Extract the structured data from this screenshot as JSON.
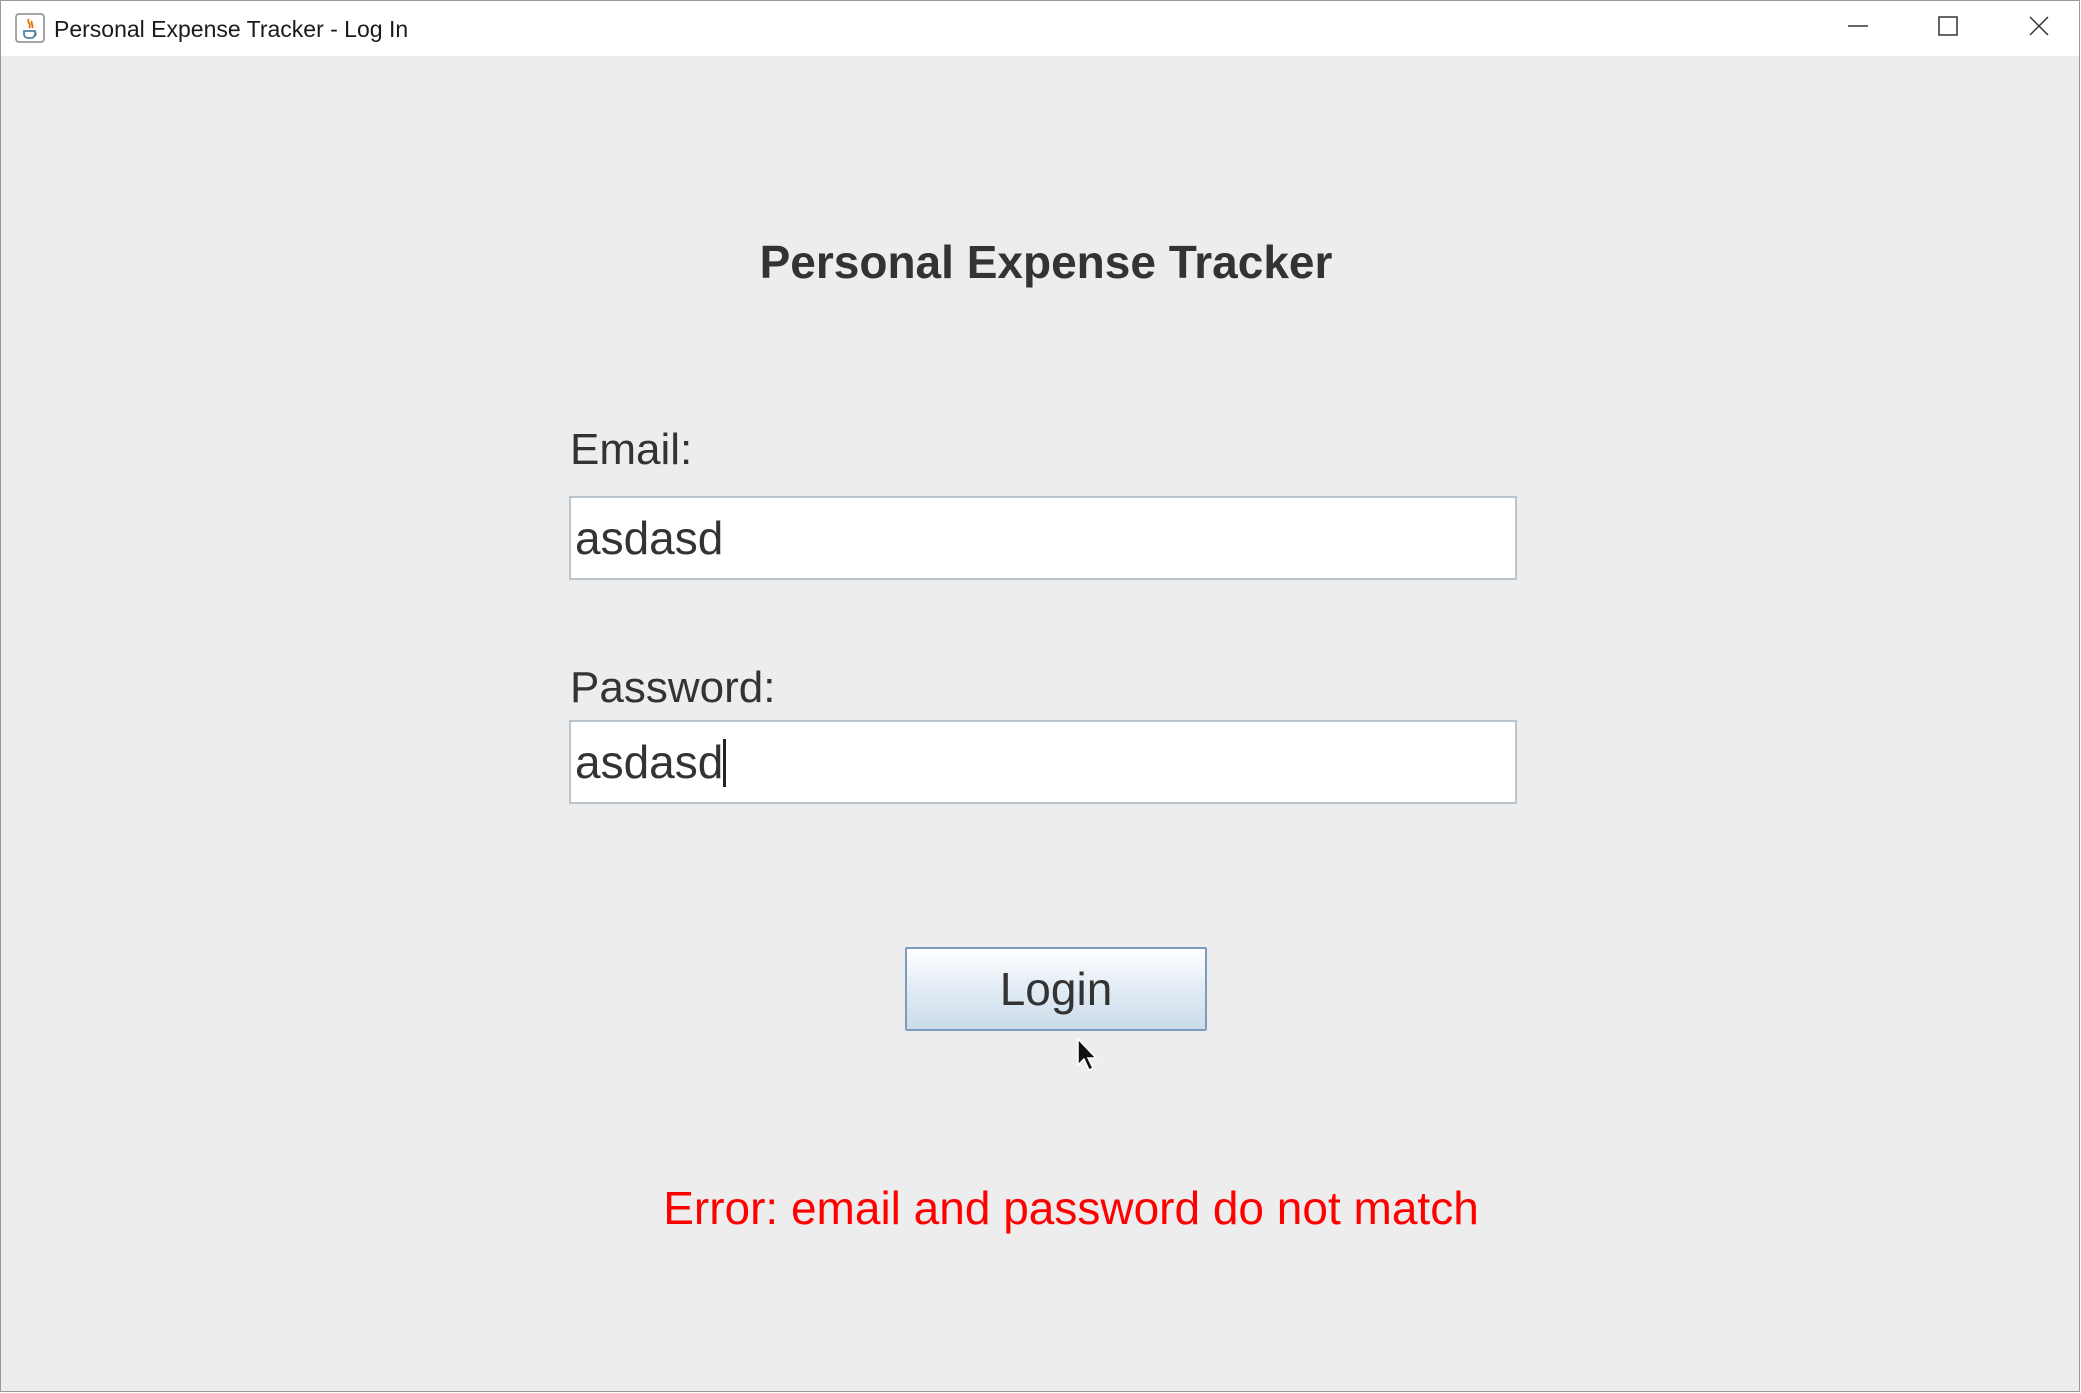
{
  "window": {
    "title": "Personal Expense Tracker - Log In"
  },
  "icons": {
    "app": "java-app-icon",
    "minimize": "minimize-icon",
    "maximize": "maximize-icon",
    "close": "close-icon"
  },
  "form": {
    "heading": "Personal Expense Tracker",
    "email_label": "Email:",
    "email_value": "asdasd",
    "password_label": "Password:",
    "password_value": "asdasd",
    "login_label": "Login"
  },
  "status": {
    "error_text": "Error: email and password do not match",
    "error_color": "#ff0000"
  },
  "colors": {
    "background": "#ededed",
    "titlebar": "#ffffff",
    "button_border": "#7a9cbf"
  }
}
